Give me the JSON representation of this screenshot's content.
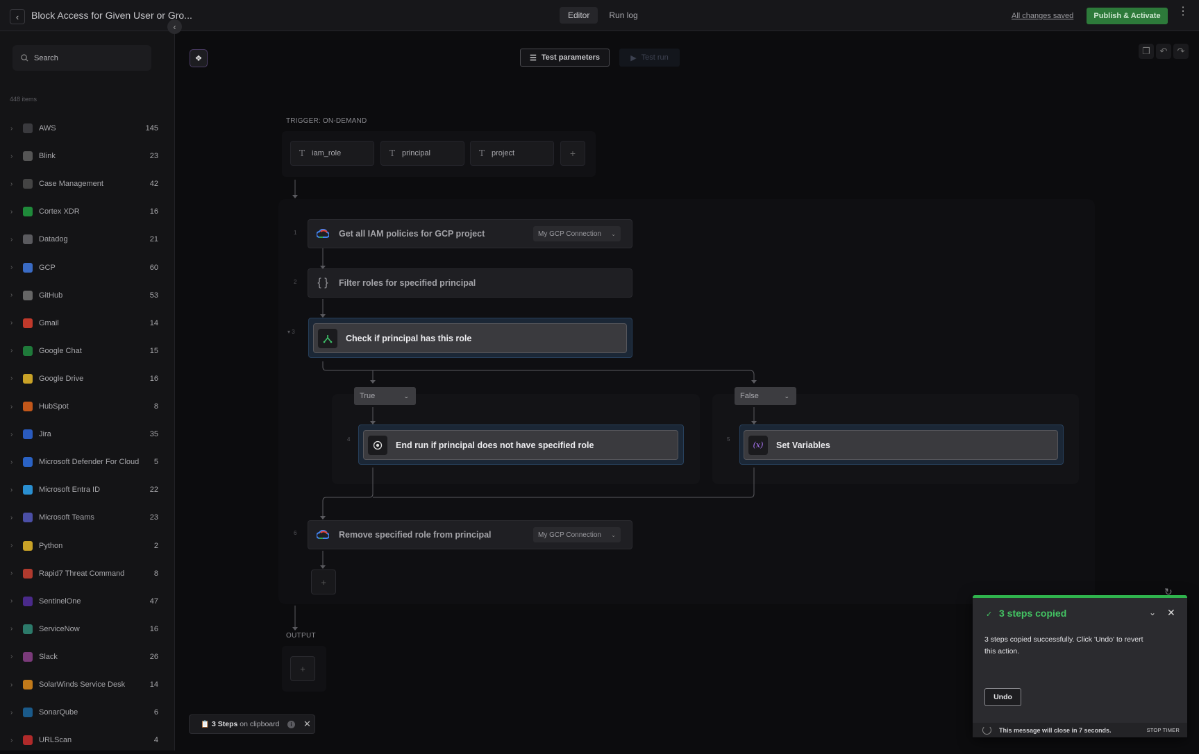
{
  "header": {
    "title": "Block Access for Given User or Gro...",
    "tabs": [
      {
        "label": "Editor",
        "active": true
      },
      {
        "label": "Run log",
        "active": false
      }
    ],
    "save_status": "All changes saved",
    "publish_label": "Publish & Activate"
  },
  "sidebar": {
    "search_placeholder": "Search",
    "items_count": "448 items",
    "items": [
      {
        "name": "AWS",
        "count": "145",
        "color": "#3a3a3e"
      },
      {
        "name": "Blink",
        "count": "23",
        "color": "#555"
      },
      {
        "name": "Case Management",
        "count": "42",
        "color": "#444"
      },
      {
        "name": "Cortex XDR",
        "count": "16",
        "color": "#1f8a3a"
      },
      {
        "name": "Datadog",
        "count": "21",
        "color": "#5a5a5e"
      },
      {
        "name": "GCP",
        "count": "60",
        "color": "#3a6bc4"
      },
      {
        "name": "GitHub",
        "count": "53",
        "color": "#666"
      },
      {
        "name": "Gmail",
        "count": "14",
        "color": "#c0392b"
      },
      {
        "name": "Google Chat",
        "count": "15",
        "color": "#1f7a3a"
      },
      {
        "name": "Google Drive",
        "count": "16",
        "color": "#c9a227"
      },
      {
        "name": "HubSpot",
        "count": "8",
        "color": "#c2571a"
      },
      {
        "name": "Jira",
        "count": "35",
        "color": "#2a5bbf"
      },
      {
        "name": "Microsoft Defender For Cloud",
        "count": "5",
        "color": "#2a62c4"
      },
      {
        "name": "Microsoft Entra ID",
        "count": "22",
        "color": "#2a8fd1"
      },
      {
        "name": "Microsoft Teams",
        "count": "23",
        "color": "#4b4fa6"
      },
      {
        "name": "Python",
        "count": "2",
        "color": "#c9a227"
      },
      {
        "name": "Rapid7 Threat Command",
        "count": "8",
        "color": "#b03a2e"
      },
      {
        "name": "SentinelOne",
        "count": "47",
        "color": "#4a2a8a"
      },
      {
        "name": "ServiceNow",
        "count": "16",
        "color": "#2c7a6a"
      },
      {
        "name": "Slack",
        "count": "26",
        "color": "#7a3a7a"
      },
      {
        "name": "SolarWinds Service Desk",
        "count": "14",
        "color": "#c27a1a"
      },
      {
        "name": "SonarQube",
        "count": "6",
        "color": "#1a5a8a"
      },
      {
        "name": "URLScan",
        "count": "4",
        "color": "#b02a2a"
      }
    ]
  },
  "toolbar": {
    "test_parameters": "Test parameters",
    "test_run": "Test run"
  },
  "flow": {
    "trigger_label": "TRIGGER: ON-DEMAND",
    "params": [
      "iam_role",
      "principal",
      "project"
    ],
    "steps": {
      "s1": {
        "num": "1",
        "label": "Get all IAM policies for GCP project",
        "connection": "My GCP Connection"
      },
      "s2": {
        "num": "2",
        "label": "Filter roles for specified principal"
      },
      "s3": {
        "num": "3",
        "label": "Check if principal has this role"
      },
      "s4": {
        "num": "4",
        "label": "End run if principal does not have specified role"
      },
      "s5": {
        "num": "5",
        "label": "Set Variables"
      },
      "s6": {
        "num": "6",
        "label": "Remove specified role from principal",
        "connection": "My GCP Connection"
      }
    },
    "branch_true": "True",
    "branch_false": "False",
    "output_label": "OUTPUT"
  },
  "clipboard": {
    "count_text": "3 Steps",
    "suffix": "on clipboard"
  },
  "toast": {
    "title": "3 steps copied",
    "message": "3 steps copied successfully. Click 'Undo' to revert this action.",
    "undo_label": "Undo",
    "footer": "This message will close in 7 seconds.",
    "stop_timer": "STOP TIMER",
    "accent": "#43c463"
  }
}
